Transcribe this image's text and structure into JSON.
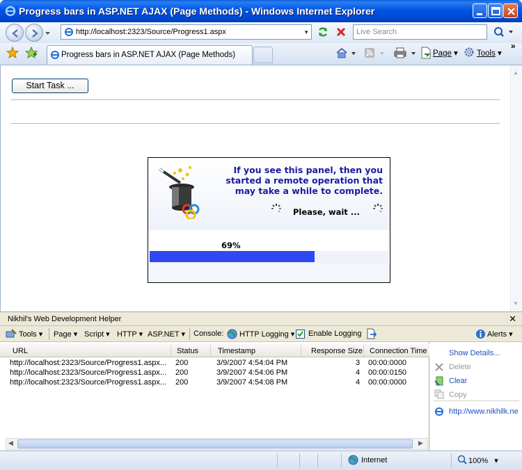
{
  "window": {
    "title": "Progress bars in ASP.NET AJAX (Page Methods) - Windows Internet Explorer"
  },
  "toolbar": {
    "address": "http://localhost:2323/Source/Progress1.aspx",
    "search_placeholder": "Live Search"
  },
  "tabs": [
    {
      "label": "Progress bars in ASP.NET AJAX (Page Methods)"
    }
  ],
  "commands": {
    "page": "Page",
    "tools": "Tools",
    "more": "»"
  },
  "page": {
    "start_button": "Start Task ...",
    "panel": {
      "message": "If you see this panel, then you started a remote operation that may take a while to complete.",
      "wait_text": "Please, wait ...",
      "progress_label": "69%",
      "progress_fraction": 0.69
    }
  },
  "helper": {
    "title": "Nikhil's Web Development Helper",
    "close": "✕",
    "menu": {
      "tools": "Tools",
      "page": "Page",
      "script": "Script",
      "http": "HTTP",
      "aspnet": "ASP.NET",
      "console": "Console:",
      "http_logging": "HTTP Logging",
      "enable_logging": "Enable Logging",
      "alerts": "Alerts"
    },
    "columns": [
      "URL",
      "Status",
      "Timestamp",
      "Response Size",
      "Connection Time"
    ],
    "rows": [
      {
        "url": "http://localhost:2323/Source/Progress1.aspx...",
        "status": "200",
        "timestamp": "3/9/2007 4:54:04 PM",
        "size": "3",
        "time": "00:00:0000"
      },
      {
        "url": "http://localhost:2323/Source/Progress1.aspx...",
        "status": "200",
        "timestamp": "3/9/2007 4:54:06 PM",
        "size": "4",
        "time": "00:00:0150"
      },
      {
        "url": "http://localhost:2323/Source/Progress1.aspx...",
        "status": "200",
        "timestamp": "3/9/2007 4:54:08 PM",
        "size": "4",
        "time": "00:00:0000"
      }
    ],
    "side": {
      "show_details": "Show Details...",
      "delete": "Delete",
      "clear": "Clear",
      "copy": "Copy",
      "link": "http://www.nikhilk.ne"
    }
  },
  "status": {
    "zone": "Internet",
    "zoom": "100%"
  }
}
